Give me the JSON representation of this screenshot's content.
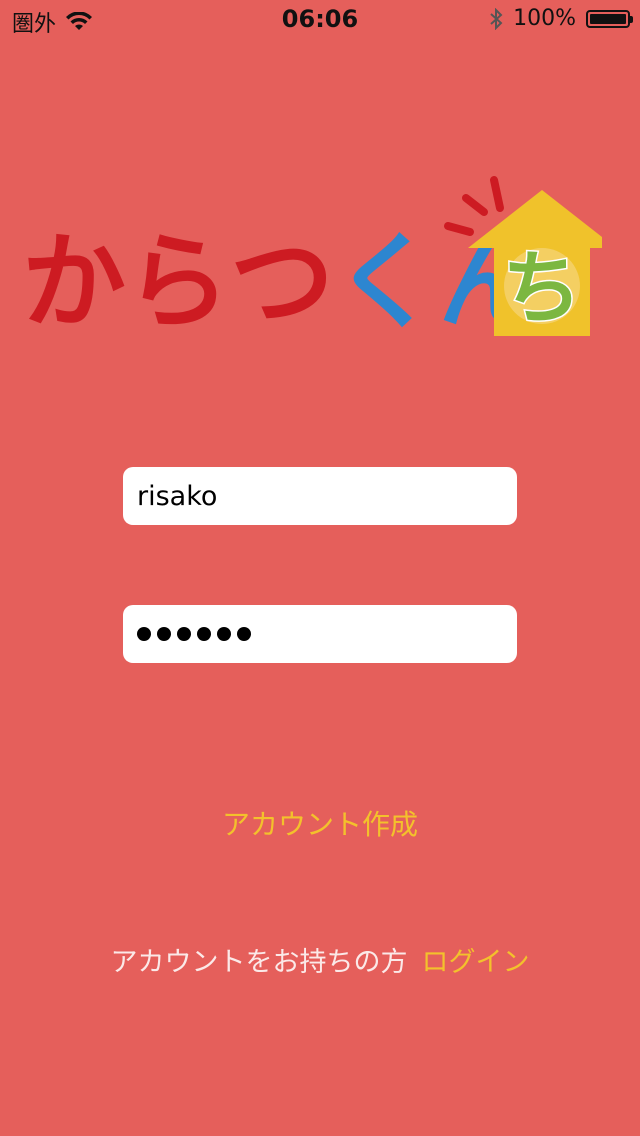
{
  "status_bar": {
    "carrier": "圏外",
    "time": "06:06",
    "battery": "100%",
    "icons": [
      "wifi-icon",
      "bluetooth-icon",
      "battery-icon"
    ]
  },
  "logo": {
    "text_main": "からつくん",
    "text_house": "ち",
    "colors": {
      "red_text": "#cd1b22",
      "blue_text": "#2d86d0",
      "house": "#f0c22b",
      "house_letter": "#7cb740"
    }
  },
  "form": {
    "username_value": "risako",
    "password_masked_count": 6
  },
  "links": {
    "create_account": "アカウント作成",
    "login_prompt": "アカウントをお持ちの方",
    "login": "ログイン"
  },
  "colors": {
    "background": "#e55f5b",
    "accent": "#f3c12c"
  }
}
